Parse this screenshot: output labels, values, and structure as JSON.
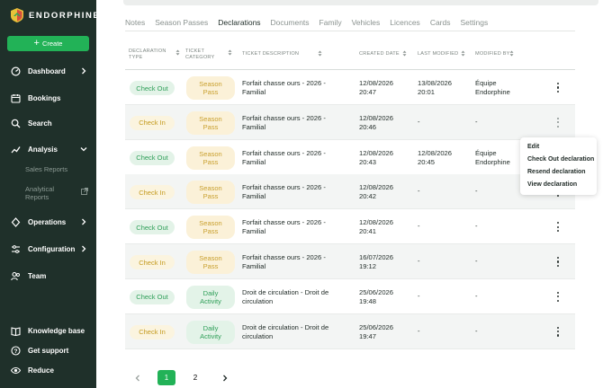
{
  "brand": {
    "name": "ENDORPHINE"
  },
  "sidebar": {
    "create_label": "Create",
    "nav": [
      {
        "label": "Dashboard",
        "icon": "dashboard-icon",
        "chevron": "right"
      },
      {
        "label": "Bookings",
        "icon": "calendar-icon"
      },
      {
        "label": "Search",
        "icon": "search-icon"
      },
      {
        "label": "Analysis",
        "icon": "analysis-icon",
        "chevron": "down"
      },
      {
        "label": "Operations",
        "icon": "operations-icon",
        "chevron": "right"
      },
      {
        "label": "Configuration",
        "icon": "sliders-icon",
        "chevron": "right"
      },
      {
        "label": "Team",
        "icon": "team-icon"
      }
    ],
    "sub": {
      "sales": "Sales Reports",
      "analytical_1": "Analytical",
      "analytical_2": "Reports"
    },
    "bottom": [
      {
        "label": "Knowledge base",
        "icon": "book-icon"
      },
      {
        "label": "Get support",
        "icon": "help-icon"
      },
      {
        "label": "Reduce",
        "icon": "eye-icon"
      }
    ]
  },
  "tabs": [
    "Notes",
    "Season Passes",
    "Declarations",
    "Documents",
    "Family",
    "Vehicles",
    "Licences",
    "Cards",
    "Settings"
  ],
  "active_tab": "Declarations",
  "table": {
    "headers": {
      "type_1": "DECLARATION",
      "type_2": "TYPE",
      "cat_1": "TICKET",
      "cat_2": "CATEGORY",
      "desc": "TICKET DESCRIPTION",
      "created": "CREATED DATE",
      "modified": "LAST MODIFIED",
      "by": "MODIFIED BY"
    },
    "rows": [
      {
        "type": "Check Out",
        "cat_1": "Season",
        "cat_2": "Pass",
        "desc_1": "Forfait chasse ours - 2026 -",
        "desc_2": "Familial",
        "created_1": "12/08/2026",
        "created_2": "20:47",
        "mod_1": "13/08/2026",
        "mod_2": "20:01",
        "by_1": "Équipe",
        "by_2": "Endorphine"
      },
      {
        "type": "Check In",
        "cat_1": "Season",
        "cat_2": "Pass",
        "desc_1": "Forfait chasse ours - 2026 -",
        "desc_2": "Familial",
        "created_1": "12/08/2026",
        "created_2": "20:46",
        "mod_1": "-",
        "mod_2": "",
        "by_1": "-",
        "by_2": ""
      },
      {
        "type": "Check Out",
        "cat_1": "Season",
        "cat_2": "Pass",
        "desc_1": "Forfait chasse ours - 2026 -",
        "desc_2": "Familial",
        "created_1": "12/08/2026",
        "created_2": "20:43",
        "mod_1": "12/08/2026",
        "mod_2": "20:45",
        "by_1": "Équipe",
        "by_2": "Endorphine"
      },
      {
        "type": "Check In",
        "cat_1": "Season",
        "cat_2": "Pass",
        "desc_1": "Forfait chasse ours - 2026 -",
        "desc_2": "Familial",
        "created_1": "12/08/2026",
        "created_2": "20:42",
        "mod_1": "-",
        "mod_2": "",
        "by_1": "-",
        "by_2": ""
      },
      {
        "type": "Check Out",
        "cat_1": "Season",
        "cat_2": "Pass",
        "desc_1": "Forfait chasse ours - 2026 -",
        "desc_2": "Familial",
        "created_1": "12/08/2026",
        "created_2": "20:41",
        "mod_1": "-",
        "mod_2": "",
        "by_1": "-",
        "by_2": ""
      },
      {
        "type": "Check In",
        "cat_1": "Season",
        "cat_2": "Pass",
        "desc_1": "Forfait chasse ours - 2026 -",
        "desc_2": "Familial",
        "created_1": "16/07/2026",
        "created_2": "19:12",
        "mod_1": "-",
        "mod_2": "",
        "by_1": "-",
        "by_2": ""
      },
      {
        "type": "Check Out",
        "cat_1": "Daily",
        "cat_2": "Activity",
        "desc_1": "Droit de circulation - Droit de",
        "desc_2": "circulation",
        "created_1": "25/06/2026",
        "created_2": "19:48",
        "mod_1": "-",
        "mod_2": "",
        "by_1": "-",
        "by_2": ""
      },
      {
        "type": "Check In",
        "cat_1": "Daily",
        "cat_2": "Activity",
        "desc_1": "Droit de circulation - Droit de",
        "desc_2": "circulation",
        "created_1": "25/06/2026",
        "created_2": "19:47",
        "mod_1": "-",
        "mod_2": "",
        "by_1": "-",
        "by_2": ""
      }
    ]
  },
  "context_menu": [
    "Edit",
    "Check Out declaration",
    "Resend declaration",
    "View declaration"
  ],
  "pagination": {
    "pages": [
      "1",
      "2"
    ],
    "current": "1"
  },
  "colors": {
    "accent": "#22b257",
    "sidebar": "#1f302a"
  }
}
